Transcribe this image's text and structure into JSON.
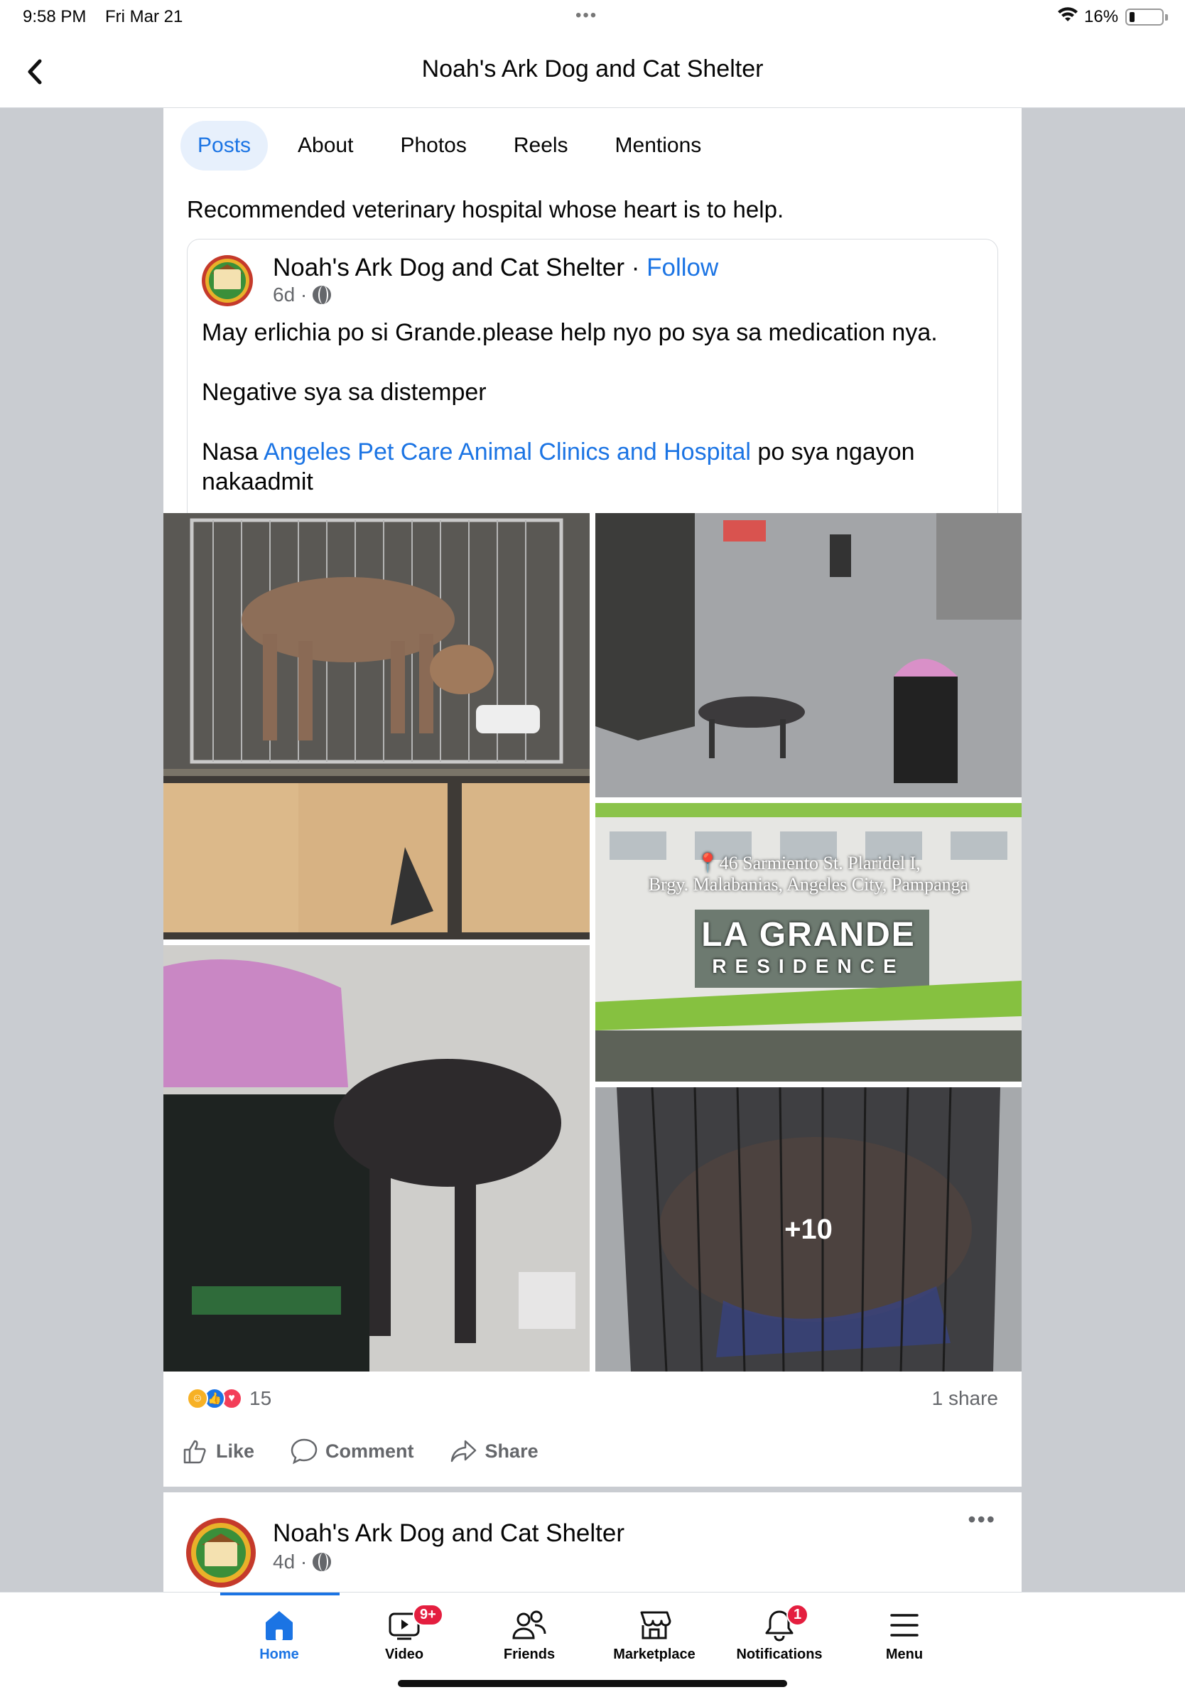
{
  "status_bar": {
    "time": "9:58 PM",
    "date": "Fri Mar 21",
    "battery": "16%"
  },
  "header": {
    "title": "Noah's Ark Dog and Cat Shelter"
  },
  "tabs": [
    {
      "label": "Posts",
      "active": true
    },
    {
      "label": "About"
    },
    {
      "label": "Photos"
    },
    {
      "label": "Reels"
    },
    {
      "label": "Mentions"
    }
  ],
  "post": {
    "caption": "Recommended veterinary hospital whose heart is to help.",
    "shared": {
      "author": "Noah's Ark Dog and Cat Shelter",
      "separator": " · ",
      "follow": "Follow",
      "time": "6d ·",
      "line1": "May erlichia po si Grande.please help nyo po sya sa medication nya.",
      "line2": "Negative sya sa distemper",
      "line3_pre": "Nasa ",
      "line3_link": "Angeles Pet Care Animal Clinics and Hospital",
      "line3_post": "  po sya ngayon",
      "line4": "nakaadmit"
    },
    "photo_overlay": {
      "address1": "📍46 Sarmiento St. Plaridel I,",
      "address2": "Brgy. Malabanias, Angeles City, Pampanga",
      "sign1": "LA GRANDE",
      "sign2": "RESIDENCE"
    },
    "more_photos": "+10",
    "reaction_count": "15",
    "shares": "1 share",
    "actions": {
      "like": "Like",
      "comment": "Comment",
      "share": "Share"
    }
  },
  "next_post": {
    "author": "Noah's Ark Dog and Cat Shelter",
    "time": "4d ·"
  },
  "bottom_nav": [
    {
      "label": "Home",
      "active": true
    },
    {
      "label": "Video",
      "badge": "9+"
    },
    {
      "label": "Friends"
    },
    {
      "label": "Marketplace"
    },
    {
      "label": "Notifications",
      "badge": "1"
    },
    {
      "label": "Menu"
    }
  ],
  "colors": {
    "accent": "#1b74e4",
    "badge": "#e41e3f",
    "background": "#c9ccd1"
  }
}
